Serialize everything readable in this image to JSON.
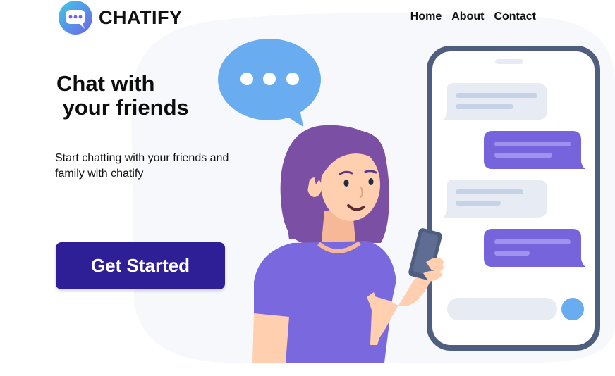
{
  "brand": {
    "name": "CHATIFY",
    "logo_icon": "chat-bubble-dots-icon",
    "gradient": [
      "#3fc9e8",
      "#6d63e8"
    ]
  },
  "nav": {
    "items": [
      {
        "label": "Home"
      },
      {
        "label": "About"
      },
      {
        "label": "Contact"
      }
    ]
  },
  "hero": {
    "title": "Chat with\n your friends",
    "subtitle": "Start chatting with your friends and family with chatify",
    "cta_label": "Get Started"
  },
  "illustration": {
    "icons": [
      "speech-bubble-icon",
      "phone-icon",
      "person-illustration"
    ]
  },
  "colors": {
    "primary": "#2f1f96",
    "bubble_blue": "#6aacf0",
    "bubble_purple": "#7564dc",
    "bubble_gray": "#e6ebf4",
    "phone_frame": "#4f5d7e",
    "shirt": "#7a68de",
    "hair": "#7a4fa4",
    "skin": "#ffcfb0",
    "background_blob": "#f6f8fc"
  }
}
